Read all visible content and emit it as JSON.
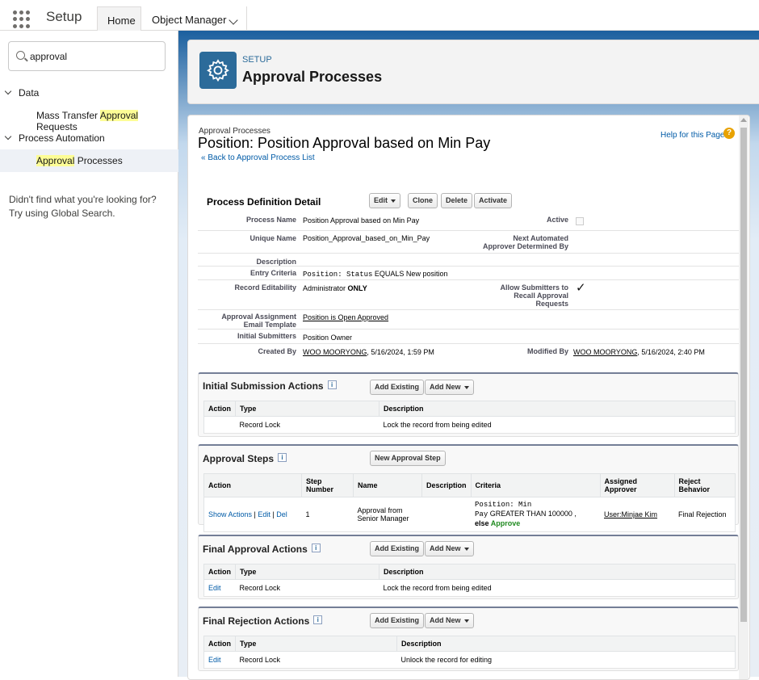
{
  "topnav": {
    "app_name": "Setup",
    "tabs": [
      {
        "label": "Home"
      },
      {
        "label": "Object Manager"
      }
    ]
  },
  "sidebar": {
    "search_value": "approval",
    "groups": [
      {
        "label": "Data",
        "items": [
          {
            "pre": "Mass Transfer ",
            "hl": "Approval",
            "post": " Requests"
          }
        ]
      },
      {
        "label": "Process Automation",
        "items": [
          {
            "pre": "",
            "hl": "Approval",
            "post": " Processes"
          }
        ]
      }
    ],
    "help_line1": "Didn't find what you're looking for?",
    "help_line2": "Try using Global Search."
  },
  "header": {
    "label": "SETUP",
    "title": "Approval Processes"
  },
  "page": {
    "breadcrumb": "Approval Processes",
    "title": "Position: Position Approval based on Min Pay",
    "back_link": "« Back to Approval Process List",
    "help_link": "Help for this Page",
    "help_icon": "?"
  },
  "detail": {
    "section_title": "Process Definition Detail",
    "buttons": {
      "edit": "Edit",
      "clone": "Clone",
      "delete": "Delete",
      "activate": "Activate"
    },
    "fields": {
      "process_name_label": "Process Name",
      "process_name": "Position Approval based on Min Pay",
      "active_label": "Active",
      "unique_name_label": "Unique Name",
      "unique_name": "Position_Approval_based_on_Min_Pay",
      "next_approver_label1": "Next Automated",
      "next_approver_label2": "Approver Determined By",
      "description_label": "Description",
      "entry_criteria_label": "Entry Criteria",
      "entry_criteria_mono": "Position: Status",
      "entry_criteria_rest": " EQUALS New position",
      "record_editability_label": "Record Editability",
      "record_editability_pre": "Administrator ",
      "record_editability_bold": "ONLY",
      "allow_recall_label1": "Allow Submitters to",
      "allow_recall_label2": "Recall Approval",
      "allow_recall_label3": "Requests",
      "allow_recall_check": "✓",
      "email_template_label1": "Approval Assignment",
      "email_template_label2": "Email Template",
      "email_template": "Position is Open Approved",
      "initial_submitters_label": "Initial Submitters",
      "initial_submitters": "Position Owner",
      "created_by_label": "Created By",
      "created_by_user": "WOO MOORYONG",
      "created_by_date": ", 5/16/2024, 1:59 PM",
      "modified_by_label": "Modified By",
      "modified_by_user": "WOO MOORYONG",
      "modified_by_date": ", 5/16/2024, 2:40 PM"
    }
  },
  "initial_submission": {
    "title": "Initial Submission Actions",
    "btn_add_existing": "Add Existing",
    "btn_add_new": "Add New",
    "headers": [
      "Action",
      "Type",
      "Description"
    ],
    "rows": [
      {
        "action": "",
        "type": "Record Lock",
        "description": "Lock the record from being edited"
      }
    ]
  },
  "approval_steps": {
    "title": "Approval Steps",
    "btn_new": "New Approval Step",
    "headers": [
      "Action",
      "Step Number",
      "Name",
      "Description",
      "Criteria",
      "Assigned Approver",
      "Reject Behavior"
    ],
    "row": {
      "show_actions": "Show Actions",
      "edit": "Edit",
      "del": "Del",
      "sep": " | ",
      "step_number": "1",
      "name_line1": "Approval from",
      "name_line2": "Senior Manager",
      "description": "",
      "criteria_mono1": "Position: Min",
      "criteria_mono2": "Pay",
      "criteria_rest": " GREATER THAN 100000 ,",
      "criteria_else": "else ",
      "criteria_approve": "Approve",
      "approver": "User:Minjae Kim",
      "reject_behavior": "Final Rejection"
    }
  },
  "final_approval": {
    "title": "Final Approval Actions",
    "btn_add_existing": "Add Existing",
    "btn_add_new": "Add New",
    "headers": [
      "Action",
      "Type",
      "Description"
    ],
    "rows": [
      {
        "action": "Edit",
        "type": "Record Lock",
        "description": "Lock the record from being edited"
      }
    ]
  },
  "final_rejection": {
    "title": "Final Rejection Actions",
    "btn_add_existing": "Add Existing",
    "btn_add_new": "Add New",
    "headers": [
      "Action",
      "Type",
      "Description"
    ],
    "rows": [
      {
        "action": "Edit",
        "type": "Record Lock",
        "description": "Unlock the record for editing"
      }
    ]
  }
}
